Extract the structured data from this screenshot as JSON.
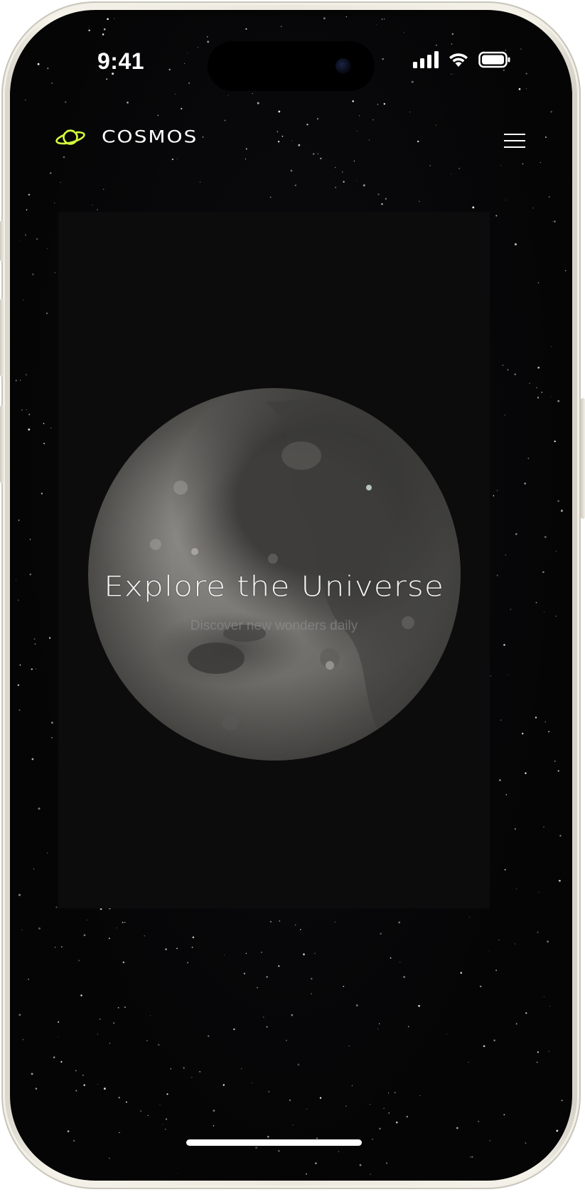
{
  "status_bar": {
    "time": "9:41"
  },
  "header": {
    "brand": "COSMOS",
    "logo_icon": "planet-icon",
    "menu_icon": "hamburger-menu-icon"
  },
  "hero": {
    "title": "Explore the Universe",
    "subtitle": "Discover new wonders daily"
  },
  "colors": {
    "accent": "#d4ff3a",
    "background": "#060607",
    "hero_panel": "#0c0c0d",
    "text": "#ffffff"
  }
}
